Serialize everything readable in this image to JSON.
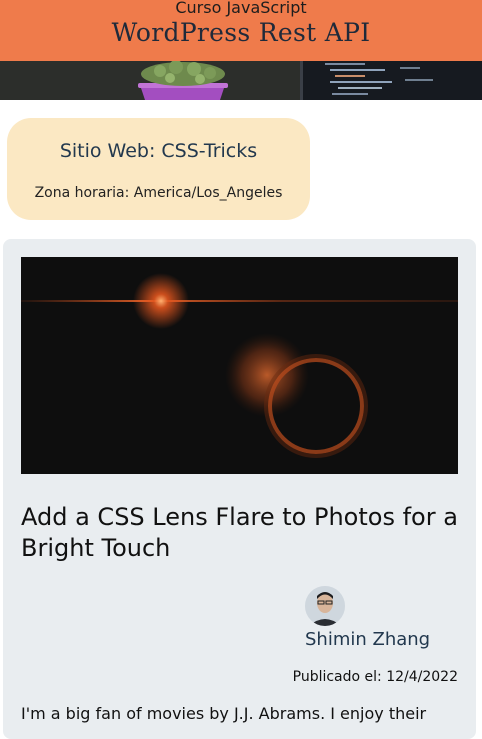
{
  "header": {
    "subtitle": "Curso JavaScript",
    "title": "WordPress Rest API"
  },
  "site": {
    "name": "Sitio Web: CSS-Tricks",
    "timezone": "Zona horaria: America/Los_Angeles"
  },
  "post": {
    "title": "Add a CSS Lens Flare to Photos for a Bright Touch",
    "author": "Shimin Zhang",
    "published": "Publicado el: 12/4/2022",
    "excerpt": "I'm a big fan of movies by J.J. Abrams. I enjoy their"
  },
  "colors": {
    "header_bg": "#ef7b4b",
    "site_card_bg": "#fbe8c3",
    "post_card_bg": "#e9edf0",
    "link_text": "#22384e"
  }
}
